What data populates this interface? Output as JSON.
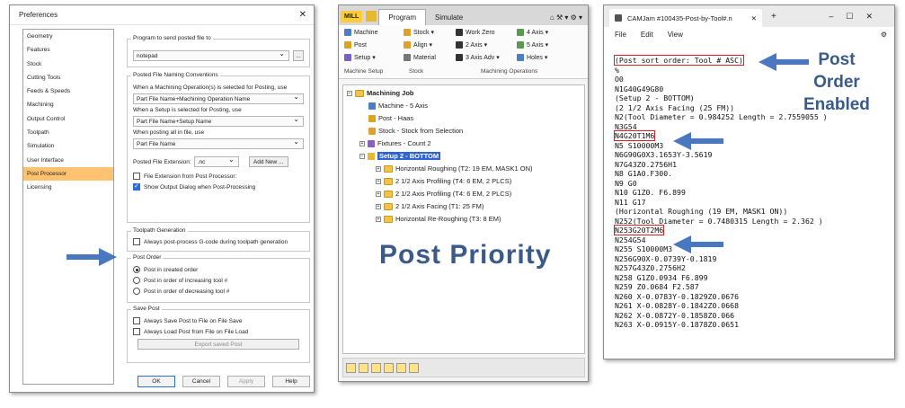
{
  "prefs": {
    "title": "Preferences",
    "close": "✕",
    "sidebar": [
      "Geometry",
      "Features",
      "Stock",
      "Cutting Tools",
      "Feeds & Speeds",
      "Machining",
      "Output Control",
      "Toolpath",
      "Simulation",
      "User Interface",
      "Post Processor",
      "Licensing"
    ],
    "prog_group": "Program to send posted file to",
    "prog_value": "notepad",
    "browse": "...",
    "naming_group": "Posted File Naming Conventions",
    "naming_l1": "When a Machining Operation(s) is selected for Posting, use",
    "naming_v1": "Part File Name+Machining Operation Name",
    "naming_l2": "When a Setup is selected for Posting, use",
    "naming_v2": "Part File Name+Setup Name",
    "naming_l3": "When posting all in file, use",
    "naming_v3": "Part File Name",
    "ext_label": "Posted File Extension:",
    "ext_value": ".nc",
    "add_new": "Add New ...",
    "ext_from_post": "File Extension from Post Processor:",
    "show_output": "Show Output Dialog when Post-Processing",
    "tp_group": "Toolpath Generation",
    "tp_always": "Always post-process G-code during toolpath generation",
    "order_group": "Post Order",
    "order_opts": [
      "Post in created order",
      "Post in order of increasing tool #",
      "Post in order of decreasing tool #"
    ],
    "save_group": "Save Post",
    "save_always": "Always Save Post to File on File Save",
    "load_always": "Always Load Post from File on File Load",
    "export": "Export saved Post",
    "ok": "OK",
    "cancel": "Cancel",
    "apply": "Apply",
    "help": "Help"
  },
  "mill": {
    "mill_tab": "MILL",
    "tabs": [
      "Program",
      "Simulate"
    ],
    "ribbon": {
      "machine": "Machine",
      "post": "Post",
      "setup": "Setup ▾",
      "stock": "Stock ▾",
      "align": "Align ▾",
      "material": "Material",
      "work_zero": "Work Zero",
      "axis2": "2 Axis ▾",
      "axis3": "3 Axis Adv ▾",
      "axis4": "4 Axis ▾",
      "axis5": "5 Axis ▾",
      "holes": "Holes ▾",
      "g1": "Machine Setup",
      "g2": "Stock",
      "g3": "Machining Operations"
    },
    "tree": {
      "job": "Machining Job",
      "machine": "Machine - 5 Axis",
      "post": "Post - Haas",
      "stock": "Stock - Stock from Selection",
      "fixtures": "Fixtures - Count 2",
      "setup": "Setup 2 - BOTTOM",
      "ops": [
        "Horizontal Roughing (T2: 19 EM, MASK1 ON)",
        "2 1/2 Axis Profiling (T4: 6 EM, 2 PLCS)",
        "2 1/2 Axis Profiling (T4: 6 EM, 2 PLCS)",
        "2 1/2 Axis Facing (T1: 25 FM)",
        "Horizontal Re-Roughing (T3: 8 EM)"
      ]
    },
    "overlay": "Post Priority"
  },
  "cam": {
    "tab": "CAMJam #100435-Post-by-Tool#.n",
    "menu": [
      "File",
      "Edit",
      "View"
    ],
    "lines": [
      "(Post sort order: Tool # ASC)",
      "%",
      "O0",
      "N1G40G49G80",
      "(Setup 2 - BOTTOM)",
      "(2 1/2 Axis Facing (25 FM))",
      "N2(Tool Diameter = 0.984252 Length = 2.7559055 )",
      "N3G54",
      "N4G20T1M6",
      "N5 S10000M3",
      "N6G90G0X3.1653Y-3.5619",
      "N7G43Z0.2756H1",
      "N8 G1A0.F300.",
      "N9 G0",
      "N10 G1Z0. F6.899",
      "N11 G17",
      "(Horizontal Roughing (19 EM, MASK1 ON))",
      "N252(Tool Diameter = 0.7480315 Length = 2.362 )",
      "N253G20T2M6",
      "N254G54",
      "N255 S10000M3",
      "N256G90X-0.0739Y-0.1819",
      "N257G43Z0.2756H2",
      "N258 G1Z0.0934 F6.899",
      "N259 Z0.0684 F2.587",
      "N260 X-0.0783Y-0.1829Z0.0676",
      "N261 X-0.0828Y-0.1842Z0.0668",
      "N262 X-0.0872Y-0.1858Z0.066",
      "N263 X-0.0915Y-0.1878Z0.0651"
    ],
    "annot": "Post\nOrder\nEnabled"
  },
  "colors": {
    "arrow": "#4a78c0",
    "accent": "#ffc270",
    "highlight": "#d82020"
  }
}
